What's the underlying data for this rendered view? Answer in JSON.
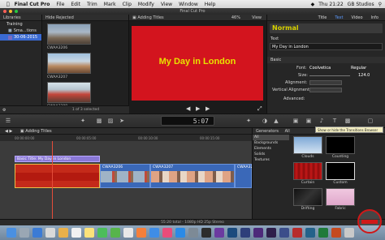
{
  "menubar": {
    "app": "Final Cut Pro",
    "items": [
      "File",
      "Edit",
      "Trim",
      "Mark",
      "Clip",
      "Modify",
      "View",
      "Window",
      "Help"
    ],
    "clock": "Thu 21:22",
    "user": "GB Studios"
  },
  "window": {
    "title": "Final Cut Pro"
  },
  "libraries": {
    "header": "Libraries",
    "items": [
      "Training",
      "Sma...tions",
      "30-06-2015"
    ],
    "footer_icon": "gear-icon"
  },
  "browser": {
    "header": "Hide Rejected",
    "clips": [
      "CWAA3206",
      "CWAA3207",
      "CWAA3208"
    ],
    "footer": "1 of 3 selected"
  },
  "viewer": {
    "title": "Adding Titles",
    "zoom": "46%",
    "view_menu": "View",
    "title_text": "My Day in London"
  },
  "inspector": {
    "tabs": [
      "Title",
      "Text",
      "Video",
      "Info"
    ],
    "preset": "Normal",
    "text_label": "Text",
    "text_value": "My Day in London",
    "basic_label": "Basic",
    "font_label": "Font:",
    "font_value": "Coolvetica",
    "style_value": "Regular",
    "size_label": "Size:",
    "size_value": "124.0",
    "alignment_label": "Alignment:",
    "valignment_label": "Vertical Alignment:",
    "advanced_label": "Advanced:"
  },
  "toolbar": {
    "timecode": "5:07"
  },
  "timeline": {
    "project": "Adding Titles",
    "ruler": [
      "00:00:00:00",
      "00:00:05:00",
      "00:00:10:00",
      "00:00:15:00"
    ],
    "title_clip": "Basic Title: My Day in London",
    "clips": [
      "CWAA3206",
      "CWAA3207",
      "CWAA3208"
    ]
  },
  "generators": {
    "header": "Generators",
    "all": "All",
    "tooltip": "Show or hide the Transitions Browser",
    "categories": [
      "All",
      "Backgrounds",
      "Elements",
      "Solids",
      "Textures"
    ],
    "items": [
      "Clouds",
      "Counting",
      "Curtain",
      "Custom",
      "Drifting",
      "Fabric"
    ]
  },
  "status": {
    "text": "55:20 total - 1080p HD 25p Stereo"
  },
  "colors": {
    "accent": "#3a6ad2",
    "title_bg": "#d3141e",
    "title_fg": "#e8e100",
    "clip_blue": "#3a68b8",
    "title_clip": "#8a78d6"
  }
}
